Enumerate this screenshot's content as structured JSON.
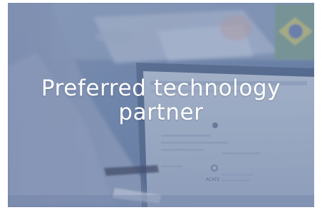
{
  "card": {
    "headline_line1": "Preferred technology",
    "headline_line2": "partner",
    "background_image": "blurred-photo-hands-typing-on-laptop",
    "overlay_color": "#5c76a0"
  },
  "photo_details": {
    "laptop_brand_text": "ACATE"
  }
}
